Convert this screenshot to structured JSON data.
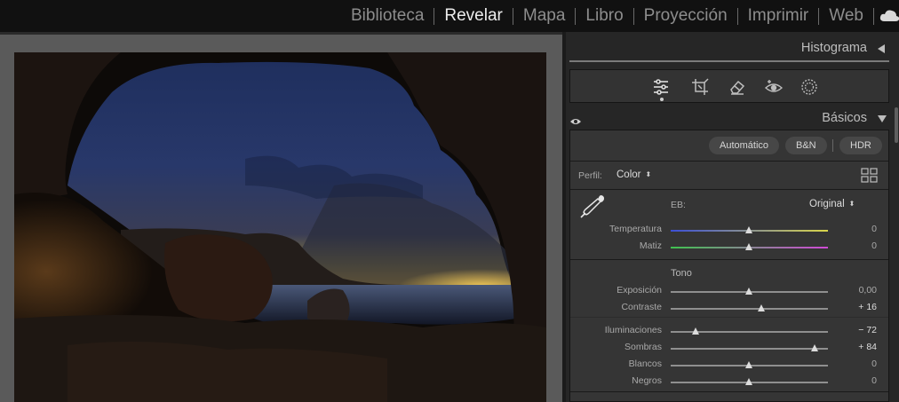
{
  "modules": {
    "items": [
      {
        "label": "Biblioteca"
      },
      {
        "label": "Revelar"
      },
      {
        "label": "Mapa"
      },
      {
        "label": "Libro"
      },
      {
        "label": "Proyección"
      },
      {
        "label": "Imprimir"
      },
      {
        "label": "Web"
      }
    ],
    "active": "Revelar"
  },
  "panel": {
    "histogram_title": "Histograma",
    "basic_title": "Básicos",
    "tools": [
      "edit-sliders-icon",
      "crop-icon",
      "eraser-icon",
      "red-eye-icon",
      "mask-icon"
    ],
    "buttons": {
      "auto": "Automático",
      "bw": "B&N",
      "hdr": "HDR"
    },
    "profile": {
      "label": "Perfil:",
      "value": "Color"
    },
    "wb": {
      "label": "EB:",
      "value": "Original"
    },
    "tone_label": "Tono",
    "sliders": {
      "temperatura": {
        "label": "Temperatura",
        "value": "0",
        "pos": 0.5
      },
      "matiz": {
        "label": "Matiz",
        "value": "0",
        "pos": 0.5
      },
      "exposicion": {
        "label": "Exposición",
        "value": "0,00",
        "pos": 0.5
      },
      "contraste": {
        "label": "Contraste",
        "value": "+ 16",
        "pos": 0.58
      },
      "iluminaciones": {
        "label": "Iluminaciones",
        "value": "− 72",
        "pos": 0.16
      },
      "sombras": {
        "label": "Sombras",
        "value": "+ 84",
        "pos": 0.92
      },
      "blancos": {
        "label": "Blancos",
        "value": "0",
        "pos": 0.5
      },
      "negros": {
        "label": "Negros",
        "value": "0",
        "pos": 0.5
      }
    }
  }
}
